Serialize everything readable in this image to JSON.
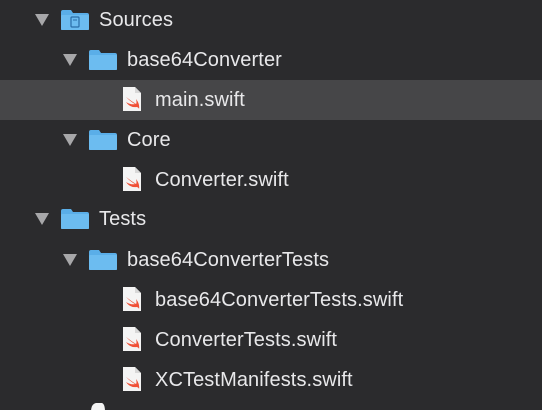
{
  "navigator": {
    "items": [
      {
        "label": "Sources",
        "kind": "group-folder",
        "expanded": true,
        "selected": false
      },
      {
        "label": "base64Converter",
        "kind": "folder",
        "expanded": true,
        "selected": false
      },
      {
        "label": "main.swift",
        "kind": "swift-file",
        "selected": true
      },
      {
        "label": "Core",
        "kind": "folder",
        "expanded": true,
        "selected": false
      },
      {
        "label": "Converter.swift",
        "kind": "swift-file",
        "selected": false
      },
      {
        "label": "Tests",
        "kind": "folder",
        "expanded": true,
        "selected": false
      },
      {
        "label": "base64ConverterTests",
        "kind": "folder",
        "expanded": true,
        "selected": false
      },
      {
        "label": "base64ConverterTests.swift",
        "kind": "swift-file",
        "selected": false
      },
      {
        "label": "ConverterTests.swift",
        "kind": "swift-file",
        "selected": false
      },
      {
        "label": "XCTestManifests.swift",
        "kind": "swift-file",
        "selected": false
      }
    ]
  },
  "colors": {
    "background": "#2b2b2d",
    "selection": "#464648",
    "folder": "#5aaee8",
    "swift": "#f05138",
    "text": "#e8e8ea"
  }
}
